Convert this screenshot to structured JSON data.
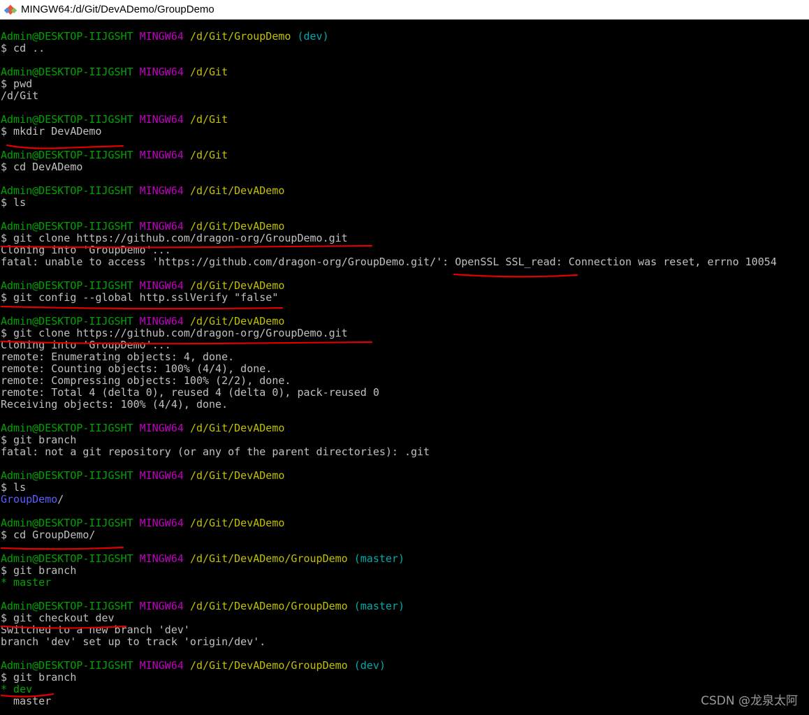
{
  "window": {
    "title": "MINGW64:/d/Git/DevADemo/GroupDemo",
    "icon": "git-bash-icon"
  },
  "colors": {
    "user": "#00a300",
    "system": "#c000c0",
    "path": "#c0c000",
    "branch": "#00aaaa",
    "output": "#c0c0c0",
    "directory": "#5c5cff",
    "annotation": "#e00000"
  },
  "terminal": {
    "lines": [
      {
        "type": "prompt",
        "user": "Admin@DESKTOP-IIJGSHT",
        "sys": "MINGW64",
        "path": "/d/Git/GroupDemo",
        "branch": "(dev)"
      },
      {
        "type": "cmd",
        "text": "$ cd .."
      },
      {
        "type": "blank"
      },
      {
        "type": "prompt",
        "user": "Admin@DESKTOP-IIJGSHT",
        "sys": "MINGW64",
        "path": "/d/Git"
      },
      {
        "type": "cmd",
        "text": "$ pwd"
      },
      {
        "type": "out",
        "text": "/d/Git"
      },
      {
        "type": "blank"
      },
      {
        "type": "prompt",
        "user": "Admin@DESKTOP-IIJGSHT",
        "sys": "MINGW64",
        "path": "/d/Git"
      },
      {
        "type": "cmd",
        "text": "$ mkdir DevADemo"
      },
      {
        "type": "blank"
      },
      {
        "type": "prompt",
        "user": "Admin@DESKTOP-IIJGSHT",
        "sys": "MINGW64",
        "path": "/d/Git"
      },
      {
        "type": "cmd",
        "text": "$ cd DevADemo"
      },
      {
        "type": "blank"
      },
      {
        "type": "prompt",
        "user": "Admin@DESKTOP-IIJGSHT",
        "sys": "MINGW64",
        "path": "/d/Git/DevADemo"
      },
      {
        "type": "cmd",
        "text": "$ ls"
      },
      {
        "type": "blank"
      },
      {
        "type": "prompt",
        "user": "Admin@DESKTOP-IIJGSHT",
        "sys": "MINGW64",
        "path": "/d/Git/DevADemo"
      },
      {
        "type": "cmd",
        "text": "$ git clone https://github.com/dragon-org/GroupDemo.git"
      },
      {
        "type": "out",
        "text": "Cloning into 'GroupDemo'..."
      },
      {
        "type": "out",
        "text": "fatal: unable to access 'https://github.com/dragon-org/GroupDemo.git/': OpenSSL SSL_read: Connection was reset, errno 10054"
      },
      {
        "type": "blank"
      },
      {
        "type": "prompt",
        "user": "Admin@DESKTOP-IIJGSHT",
        "sys": "MINGW64",
        "path": "/d/Git/DevADemo"
      },
      {
        "type": "cmd",
        "text": "$ git config --global http.sslVerify \"false\""
      },
      {
        "type": "blank"
      },
      {
        "type": "prompt",
        "user": "Admin@DESKTOP-IIJGSHT",
        "sys": "MINGW64",
        "path": "/d/Git/DevADemo"
      },
      {
        "type": "cmd",
        "text": "$ git clone https://github.com/dragon-org/GroupDemo.git"
      },
      {
        "type": "out",
        "text": "Cloning into 'GroupDemo'..."
      },
      {
        "type": "out",
        "text": "remote: Enumerating objects: 4, done."
      },
      {
        "type": "out",
        "text": "remote: Counting objects: 100% (4/4), done."
      },
      {
        "type": "out",
        "text": "remote: Compressing objects: 100% (2/2), done."
      },
      {
        "type": "out",
        "text": "remote: Total 4 (delta 0), reused 4 (delta 0), pack-reused 0"
      },
      {
        "type": "out",
        "text": "Receiving objects: 100% (4/4), done."
      },
      {
        "type": "blank"
      },
      {
        "type": "prompt",
        "user": "Admin@DESKTOP-IIJGSHT",
        "sys": "MINGW64",
        "path": "/d/Git/DevADemo"
      },
      {
        "type": "cmd",
        "text": "$ git branch"
      },
      {
        "type": "out",
        "text": "fatal: not a git repository (or any of the parent directories): .git"
      },
      {
        "type": "blank"
      },
      {
        "type": "prompt",
        "user": "Admin@DESKTOP-IIJGSHT",
        "sys": "MINGW64",
        "path": "/d/Git/DevADemo"
      },
      {
        "type": "cmd",
        "text": "$ ls"
      },
      {
        "type": "dir",
        "name": "GroupDemo",
        "suffix": "/"
      },
      {
        "type": "blank"
      },
      {
        "type": "prompt",
        "user": "Admin@DESKTOP-IIJGSHT",
        "sys": "MINGW64",
        "path": "/d/Git/DevADemo"
      },
      {
        "type": "cmd",
        "text": "$ cd GroupDemo/"
      },
      {
        "type": "blank"
      },
      {
        "type": "prompt",
        "user": "Admin@DESKTOP-IIJGSHT",
        "sys": "MINGW64",
        "path": "/d/Git/DevADemo/GroupDemo",
        "branch": "(master)"
      },
      {
        "type": "cmd",
        "text": "$ git branch"
      },
      {
        "type": "current",
        "text": "* master"
      },
      {
        "type": "blank"
      },
      {
        "type": "prompt",
        "user": "Admin@DESKTOP-IIJGSHT",
        "sys": "MINGW64",
        "path": "/d/Git/DevADemo/GroupDemo",
        "branch": "(master)"
      },
      {
        "type": "cmd",
        "text": "$ git checkout dev"
      },
      {
        "type": "out",
        "text": "Switched to a new branch 'dev'"
      },
      {
        "type": "out",
        "text": "branch 'dev' set up to track 'origin/dev'."
      },
      {
        "type": "blank"
      },
      {
        "type": "prompt",
        "user": "Admin@DESKTOP-IIJGSHT",
        "sys": "MINGW64",
        "path": "/d/Git/DevADemo/GroupDemo",
        "branch": "(dev)"
      },
      {
        "type": "cmd",
        "text": "$ git branch"
      },
      {
        "type": "current",
        "text": "* dev"
      },
      {
        "type": "out",
        "text": "  master"
      }
    ]
  },
  "watermark": "CSDN @龙泉太阿"
}
